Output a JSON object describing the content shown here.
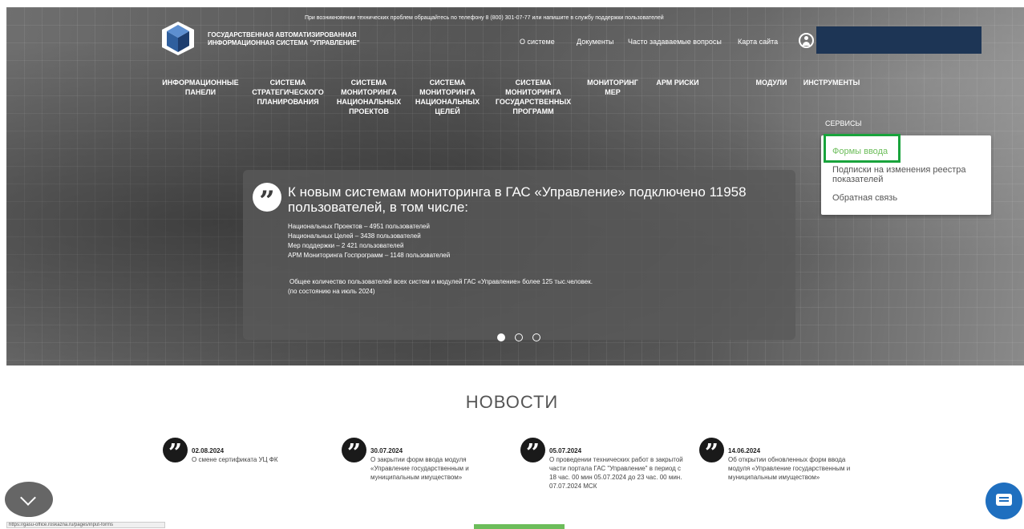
{
  "header": {
    "top_note": "При возникновении технических проблем обращайтесь по телефону 8 (800) 301-07-77 или напишите в службу поддержки пользователей",
    "logo_line1": "ГОСУДАРСТВЕННАЯ АВТОМАТИЗИРОВАННАЯ",
    "logo_line2": "ИНФОРМАЦИОННАЯ СИСТЕМА \"УПРАВЛЕНИЕ\"",
    "top_links": [
      "О системе",
      "Документы",
      "Часто задаваемые вопросы",
      "Карта сайта"
    ]
  },
  "main_menu": [
    [
      "ИНФОРМАЦИОННЫЕ",
      "ПАНЕЛИ"
    ],
    [
      "СИСТЕМА",
      "СТРАТЕГИЧЕСКОГО",
      "ПЛАНИРОВАНИЯ"
    ],
    [
      "СИСТЕМА",
      "МОНИТОРИНГА",
      "НАЦИОНАЛЬНЫХ",
      "ПРОЕКТОВ"
    ],
    [
      "СИСТЕМА",
      "МОНИТОРИНГА",
      "НАЦИОНАЛЬНЫХ",
      "ЦЕЛЕЙ"
    ],
    [
      "СИСТЕМА",
      "МОНИТОРИНГА",
      "ГОСУДАРСТВЕННЫХ",
      "ПРОГРАММ"
    ],
    [
      "МОНИТОРИНГ",
      "МЕР"
    ],
    [
      "АРМ РИСКИ"
    ],
    [
      "МОДУЛИ"
    ],
    [
      "ИНСТРУМЕНТЫ"
    ]
  ],
  "dropdown": {
    "heading": "СЕРВИСЫ",
    "items": [
      "Формы ввода",
      "Подписки на изменения реестра показателей",
      "Обратная связь"
    ]
  },
  "banner": {
    "title": "К новым системам мониторинга в ГАС «Управление» подключено 11958 пользователей, в том числе:",
    "lines": [
      "Национальных Проектов – 4951 пользователей",
      "Национальных Целей – 3438 пользователей",
      "Мер поддержки – 2 421 пользователей",
      "АРМ Мониторинга Госпрограмм – 1148 пользователей"
    ],
    "footer1": "Общее количество пользователей всех систем и модулей ГАС «Управление» более 125 тыс.человек.",
    "footer2": "(по состоянию на июль 2024)"
  },
  "news": {
    "title": "НОВОСТИ",
    "items": [
      {
        "date": "02.08.2024",
        "text": "О смене сертификата УЦ ФК"
      },
      {
        "date": "30.07.2024",
        "text": "О закрытии форм ввода модуля «Управление государственным и муниципальным имуществом»"
      },
      {
        "date": "05.07.2024",
        "text": "О проведении технических работ в закрытой части портала ГАС \"Управление\" в период с 18 час. 00 мин 05.07.2024 до 23 час. 00 мин. 07.07.2024 МСК"
      },
      {
        "date": "14.06.2024",
        "text": "Об открытии обновленных форм ввода модуля «Управление государственным и муниципальным имуществом»"
      }
    ]
  },
  "status_url": "https://gasu-office.roskazna.ru/pages/input-forms"
}
